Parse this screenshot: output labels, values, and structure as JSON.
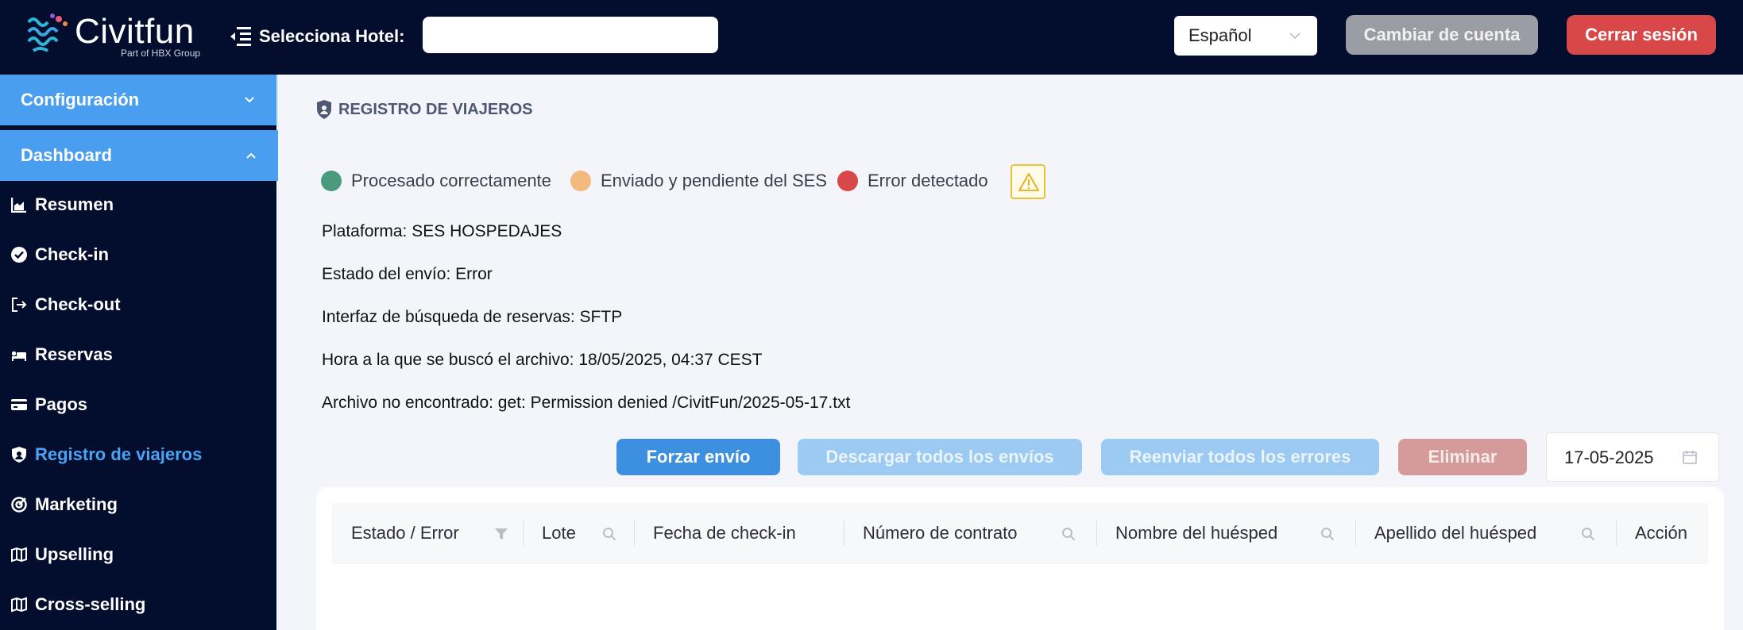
{
  "brand": {
    "name": "Civitfun",
    "tagline": "Part of HBX Group"
  },
  "header": {
    "hotel_label": "Selecciona Hotel:",
    "hotel_value": "",
    "language": "Español",
    "switch_account": "Cambiar de cuenta",
    "logout": "Cerrar sesión",
    "colors": {
      "bg": "#030d2d",
      "logout": "#d94848",
      "switch": "#9a9da3"
    }
  },
  "sidebar": {
    "sections": [
      {
        "label": "Configuración",
        "expanded": false
      },
      {
        "label": "Dashboard",
        "expanded": true
      }
    ],
    "items": [
      {
        "label": "Resumen",
        "icon": "chart-area-icon"
      },
      {
        "label": "Check-in",
        "icon": "check-circle-icon"
      },
      {
        "label": "Check-out",
        "icon": "sign-out-icon"
      },
      {
        "label": "Reservas",
        "icon": "bed-icon"
      },
      {
        "label": "Pagos",
        "icon": "credit-card-icon"
      },
      {
        "label": "Registro de viajeros",
        "icon": "shield-icon",
        "active": true
      },
      {
        "label": "Marketing",
        "icon": "bullseye-icon"
      },
      {
        "label": "Upselling",
        "icon": "map-icon"
      },
      {
        "label": "Cross-selling",
        "icon": "map-icon"
      }
    ],
    "colors": {
      "accordion": "#4a9ef0",
      "active": "#4aa3f5"
    }
  },
  "page": {
    "title": "REGISTRO DE VIAJEROS",
    "legend": [
      {
        "label": "Procesado correctamente",
        "color": "#4a9a7e"
      },
      {
        "label": "Enviado y pendiente del SES",
        "color": "#f3b97d"
      },
      {
        "label": "Error detectado",
        "color": "#d94848"
      }
    ],
    "info": [
      "Plataforma: SES HOSPEDAJES",
      "Estado del envío: Error",
      "Interfaz de búsqueda de reservas: SFTP",
      "Hora a la que se buscó el archivo: 18/05/2025, 04:37 CEST",
      "Archivo no encontrado: get: Permission denied /CivitFun/2025-05-17.txt"
    ],
    "actions": {
      "force": "Forzar envío",
      "download_all": "Descargar todos los envíos",
      "resend_errors": "Reenviar todos los errores",
      "delete": "Eliminar"
    },
    "date": "17-05-2025"
  },
  "table": {
    "columns": [
      {
        "label": "Estado / Error",
        "icon": "filter-icon"
      },
      {
        "label": "Lote",
        "icon": "search-icon"
      },
      {
        "label": "Fecha de check-in",
        "icon": ""
      },
      {
        "label": "Número de contrato",
        "icon": "search-icon"
      },
      {
        "label": "Nombre del huésped",
        "icon": "search-icon"
      },
      {
        "label": "Apellido del huésped",
        "icon": "search-icon"
      },
      {
        "label": "Acción",
        "icon": ""
      }
    ]
  }
}
